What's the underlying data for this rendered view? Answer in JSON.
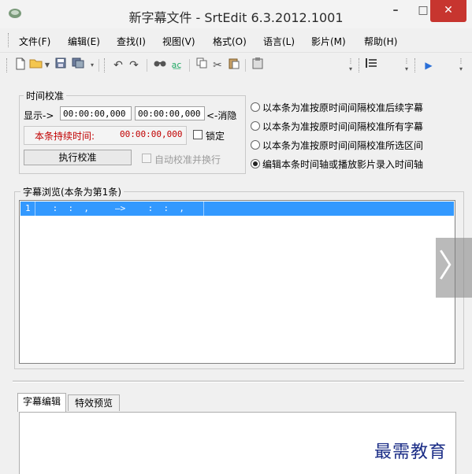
{
  "window": {
    "title": "新字幕文件 - SrtEdit 6.3.2012.1001",
    "minimize_symbol": "–",
    "maximize_symbol": "□",
    "close_symbol": "✕",
    "app_icon": "srtedit-app-icon"
  },
  "menu": [
    "文件(F)",
    "编辑(E)",
    "查找(I)",
    "视图(V)",
    "格式(O)",
    "语言(L)",
    "影片(M)",
    "帮助(H)"
  ],
  "toolbar": {
    "icons": [
      "new-file-icon",
      "open-folder-icon",
      "save-icon",
      "save-as-icon",
      "undo-icon",
      "redo-icon",
      "find-icon",
      "replace-icon",
      "copy-icon",
      "cut-icon",
      "paste-icon",
      "clipboard-icon",
      "list-icon",
      "play-icon"
    ]
  },
  "timing": {
    "group_label": "时间校准",
    "show_label": "显示->",
    "start_time": "00:00:00,000",
    "end_time": "00:00:00,000",
    "hide_label": "<-消隐",
    "duration_label": "本条持续时间:",
    "duration_value": "00:00:00,000",
    "lock_label": "锁定",
    "lock_checked": false,
    "execute_button": "执行校准",
    "auto_label": "自动校准并换行",
    "auto_enabled": false,
    "options": [
      {
        "label": "以本条为准按原时间间隔校准后续字幕",
        "selected": false
      },
      {
        "label": "以本条为准按原时间间隔校准所有字幕",
        "selected": false
      },
      {
        "label": "以本条为准按原时间间隔校准所选区间",
        "selected": false
      },
      {
        "label": "编辑本条时间轴或播放影片录入时间轴",
        "selected": true
      }
    ]
  },
  "browse": {
    "group_label": "字幕浏览(本条为第1条)",
    "rows": [
      {
        "index": "1",
        "start": " :  :  ,",
        "arrow": "—>",
        "end": " :  :  ,",
        "selected": true
      }
    ]
  },
  "overlay": {
    "arrow": "〉"
  },
  "editor": {
    "tabs": [
      {
        "label": "字幕编辑",
        "active": true
      },
      {
        "label": "特效预览",
        "active": false
      }
    ]
  },
  "watermark": "最需教育",
  "colors": {
    "selection": "#3399ff",
    "close_button": "#c7352f",
    "duration_text": "#c00000",
    "watermark": "#1a2c86"
  }
}
